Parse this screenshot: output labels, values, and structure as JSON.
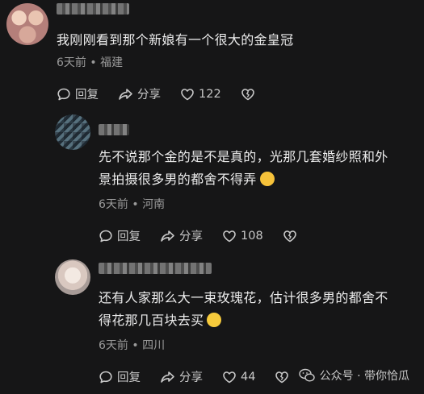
{
  "comments": [
    {
      "text": "我刚刚看到那个新娘有一个很大的金皇冠",
      "meta": "6天前 • 福建",
      "reply_label": "回复",
      "share_label": "分享",
      "likes": "122"
    },
    {
      "text_line1": "先不说那个金的是不是真的，光那几套婚纱照和外",
      "text_line2": "景拍摄很多男的都舍不得弄",
      "meta": "6天前 • 河南",
      "reply_label": "回复",
      "share_label": "分享",
      "likes": "108"
    },
    {
      "text_line1": "还有人家那么大一束玫瑰花，估计很多男的都舍不",
      "text_line2": "得花那几百块去买",
      "meta": "6天前 • 四川",
      "reply_label": "回复",
      "share_label": "分享",
      "likes": "44"
    }
  ],
  "watermark": {
    "text": "公众号 · 带你恰瓜"
  },
  "colors": {
    "background": "#161617",
    "text": "#ececec",
    "meta": "#9a9a9a",
    "icon": "#c8c8c8"
  }
}
